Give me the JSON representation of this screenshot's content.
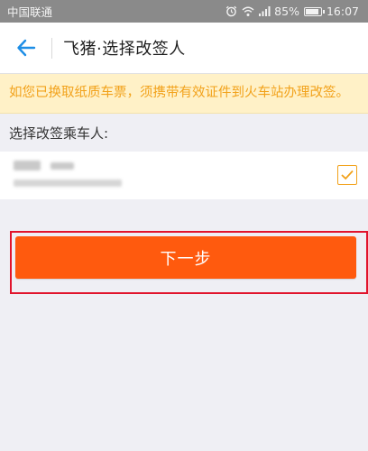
{
  "status_bar": {
    "carrier": "中国联通",
    "battery": "85%",
    "time": "16:07",
    "icons": [
      "alarm-icon",
      "wifi-icon",
      "signal-icon",
      "battery-icon"
    ]
  },
  "nav": {
    "back_icon": "back-arrow-icon",
    "title": "飞猪·选择改签人"
  },
  "notice": {
    "text": "如您已换取纸质车票，须携带有效证件到火车站办理改签。"
  },
  "section": {
    "label": "选择改签乘车人:"
  },
  "passenger": {
    "checked": true
  },
  "actions": {
    "next_label": "下一步"
  },
  "colors": {
    "accent": "#ff5a0e",
    "notice_text": "#f2a21b",
    "notice_bg": "#fff1c7",
    "back_arrow": "#1e8ee6",
    "highlight_frame": "#e1142c"
  }
}
